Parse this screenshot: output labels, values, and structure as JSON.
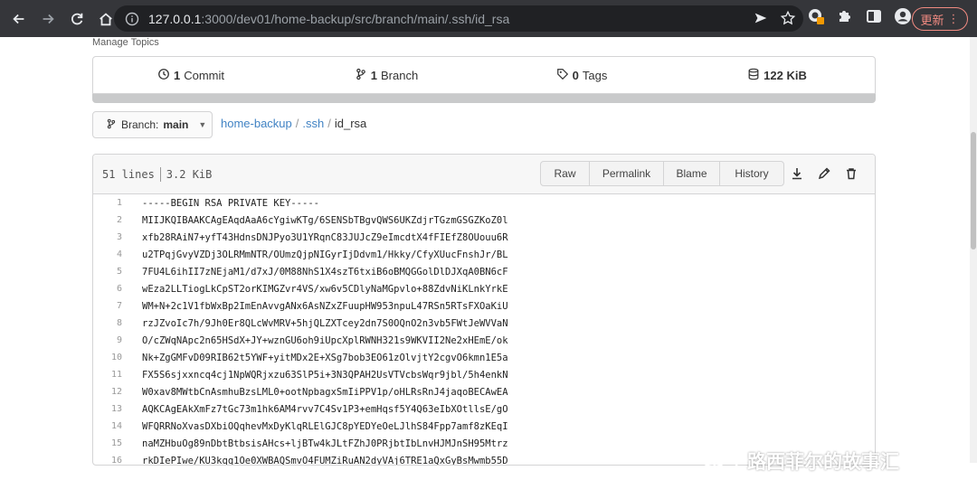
{
  "browser": {
    "url_host": "127.0.0.1",
    "url_path": ":3000/dev01/home-backup/src/branch/main/.ssh/id_rsa",
    "update_label": "更新"
  },
  "repo": {
    "manage_topics": "Manage Topics",
    "commits_count": "1",
    "commits_label": "Commit",
    "branches_count": "1",
    "branches_label": "Branch",
    "tags_count": "0",
    "tags_label": "Tags",
    "size": "122 KiB"
  },
  "branch": {
    "prefix": "Branch:",
    "name": "main"
  },
  "breadcrumb": {
    "repo": "home-backup",
    "sep1": "/",
    "dir": ".ssh",
    "sep2": "/",
    "file": "id_rsa"
  },
  "file": {
    "lines_label": "51 lines",
    "size_label": "3.2 KiB",
    "buttons": [
      "Raw",
      "Permalink",
      "Blame",
      "History"
    ]
  },
  "code_lines": [
    {
      "n": "1",
      "text": "-----BEGIN RSA PRIVATE KEY-----"
    },
    {
      "n": "2",
      "text": "MIIJKQIBAAKCAgEAqdAaA6cYgiwKTg/6SENSbTBgvQWS6UKZdjrTGzmGSGZKoZ0l"
    },
    {
      "n": "3",
      "text": "xfb28RAiN7+yfT43HdnsDNJPyo3U1YRqnC83JUJcZ9eImcdtX4fFIEfZ8OUouu6R"
    },
    {
      "n": "4",
      "text": "u2TPqjGvyVZDj3OLRMmNTR/OUmzQjpNIGyrIjDdvm1/Hkky/CfyXUucFnshJr/BL"
    },
    {
      "n": "5",
      "text": "7FU4L6ihII7zNEjaM1/d7xJ/0M88NhS1X4szT6txiB6oBMQGGolDlDJXqA0BN6cF"
    },
    {
      "n": "6",
      "text": "wEza2LLTiogLkCpST2orKIMGZvr4VS/xw6v5CDlyNaMGpvlo+88ZdvNiKLnkYrkE"
    },
    {
      "n": "7",
      "text": "WM+N+2c1V1fbWxBp2ImEnAvvgANx6AsNZxZFuupHW953npuL47RSn5RTsFXOaKiU"
    },
    {
      "n": "8",
      "text": "rzJZvoIc7h/9Jh0Er8QLcWvMRV+5hjQLZXTcey2dn7S0OQnO2n3vb5FWtJeWVVaN"
    },
    {
      "n": "9",
      "text": "O/cZWqNApc2n65HSdX+JY+wznGU6oh9iUpcXplRWNH321s9WKVII2Ne2xHEmE/ok"
    },
    {
      "n": "10",
      "text": "Nk+ZgGMFvD09RIB62t5YWF+yitMDx2E+XSg7bob3EO61zOlvjtY2cgvO6kmn1E5a"
    },
    {
      "n": "11",
      "text": "FX5S6sjxxncq4cj1NpWQRjxzu63SlP5i+3N3QPAH2UsVTVcbsWqr9jbl/5h4enkN"
    },
    {
      "n": "12",
      "text": "W0xav8MWtbCnAsmhuBzsLML0+ootNpbagxSmIiPPV1p/oHLRsRnJ4jaqoBECAwEA"
    },
    {
      "n": "13",
      "text": "AQKCAgEAkXmFz7tGc73m1hk6AM4rvv7C4Sv1P3+emHqsf5Y4Q63eIbXOtllsE/gO"
    },
    {
      "n": "14",
      "text": "WFQRRNoXvasDXbiOQqhevMxDyKlqRLElGJC8pYEDYeOeLJlhS84Fpp7amf8zKEqI"
    },
    {
      "n": "15",
      "text": "naMZHbuOg89nDbtBtbsisAHcs+ljBTw4kJLtFZhJ0PRjbtIbLnvHJMJnSH95Mtrz"
    },
    {
      "n": "16",
      "text": "rkDIePIwe/KU3kqq1Oe0XWBAQSmvO4FUMZiRuAN2dyVAj6TRE1aQxGyBsMwmb55D"
    }
  ],
  "watermark": "路西菲尔的故事汇"
}
